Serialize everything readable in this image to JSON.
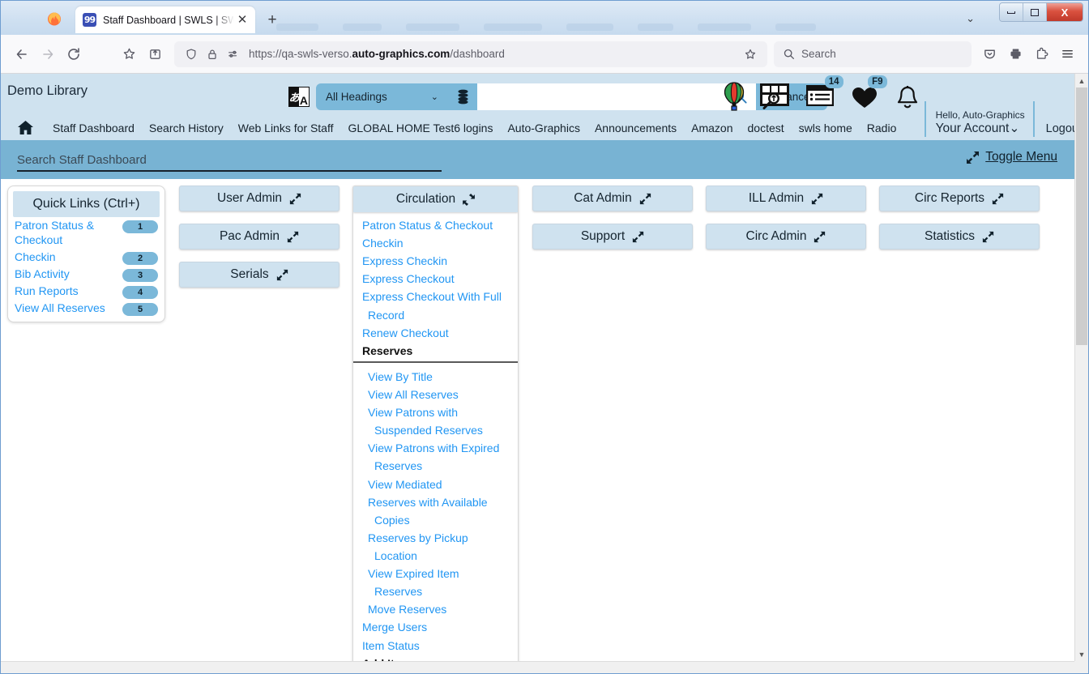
{
  "browser": {
    "tab": {
      "title": "Staff Dashboard | SWLS | SWLS",
      "favicon_name": "swls-favicon",
      "close_label": "✕"
    },
    "new_tab_label": "+",
    "list_all_tabs_label": "⌄",
    "window_controls": {
      "minimize": "minimize",
      "maximize": "maximize",
      "close": "X"
    },
    "toolbar": {
      "back": "←",
      "forward": "→",
      "reload": "↻",
      "bookmark_this": "bookmark-star",
      "save_to_collection": "save-to-collection",
      "shield": "tracking-protection",
      "lock": "connection-secure",
      "permissions": "site-permissions",
      "url_prefix": "https://qa-swls-verso.",
      "url_domain": "auto-graphics.com",
      "url_suffix": "/dashboard",
      "star": "☆",
      "search_placeholder": "Search",
      "pocket": "save-to-pocket",
      "print": "print",
      "extensions": "extensions",
      "app_menu": "≡"
    }
  },
  "app": {
    "library_name": "Demo Library",
    "search": {
      "lang_icon_letter": "A",
      "scope_value": "All Headings",
      "scope_chevron": "⌄",
      "db_icon": "database-icon",
      "input_value": "",
      "input_placeholder": "",
      "go_icon": "search-icon",
      "advanced_label": "Advanced"
    },
    "header_icons": [
      {
        "name": "balloon-icon",
        "badge": null
      },
      {
        "name": "image-search-icon",
        "badge": null
      },
      {
        "name": "list-card-icon",
        "badge": "14"
      },
      {
        "name": "heart-icon",
        "badge": "F9"
      },
      {
        "name": "bell-icon",
        "badge": null
      }
    ],
    "account": {
      "hello": "Hello, Auto-Graphics",
      "link": "Your Account",
      "chevron": "⌄"
    },
    "logout_label": "Logout",
    "nav": {
      "home_icon": "home-icon",
      "links": [
        "Staff Dashboard",
        "Search History",
        "Web Links for Staff",
        "GLOBAL HOME Test6 logins",
        "Auto-Graphics",
        "Announcements",
        "Amazon",
        "doctest",
        "swls home",
        "Radio"
      ]
    }
  },
  "dashboard": {
    "search_placeholder": "Search Staff Dashboard",
    "search_value": "",
    "toggle_menu": {
      "label": "Toggle Menu",
      "icon": "expand-arrows-icon"
    },
    "quick_links": {
      "title": "Quick Links (Ctrl+)",
      "items": [
        {
          "label": "Patron Status & Checkout",
          "badge": "1"
        },
        {
          "label": "Checkin",
          "badge": "2"
        },
        {
          "label": "Bib Activity",
          "badge": "3"
        },
        {
          "label": "Run Reports",
          "badge": "4"
        },
        {
          "label": "View All Reserves",
          "badge": "5"
        }
      ]
    },
    "column_a_buttons": [
      {
        "label": "User Admin",
        "icon": "expand-arrows-icon"
      },
      {
        "label": "Pac Admin",
        "icon": "expand-arrows-icon"
      },
      {
        "label": "Serials",
        "icon": "expand-arrows-icon"
      }
    ],
    "circulation": {
      "title": "Circulation",
      "icon": "collapse-arrows-icon",
      "items": [
        "Patron Status & Checkout",
        "Checkin",
        "Express Checkin",
        "Express Checkout",
        "Express Checkout With Full",
        "Record",
        "Renew Checkout"
      ],
      "reserves_heading": "Reserves",
      "reserves_items": [
        "View By Title",
        "View All Reserves",
        "View Patrons with",
        "Suspended Reserves",
        "View Patrons with Expired",
        "Reserves",
        "View Mediated",
        "Reserves with Available",
        "Copies",
        "Reserves by Pickup",
        "Location",
        "View Expired Item",
        "Reserves",
        "Move Reserves"
      ],
      "tail_items": [
        "Merge Users",
        "Item Status"
      ],
      "add_item_heading": "Add Item"
    },
    "column_c_buttons": [
      {
        "label": "Cat Admin",
        "icon": "expand-arrows-icon"
      },
      {
        "label": "Support",
        "icon": "expand-arrows-icon"
      }
    ],
    "column_d_buttons": [
      {
        "label": "ILL Admin",
        "icon": "expand-arrows-icon"
      },
      {
        "label": "Circ Admin",
        "icon": "expand-arrows-icon"
      }
    ],
    "column_e_buttons": [
      {
        "label": "Circ Reports",
        "icon": "expand-arrows-icon"
      },
      {
        "label": "Statistics",
        "icon": "expand-arrows-icon"
      }
    ]
  },
  "colors": {
    "app_header_bg": "#cfe2ef",
    "accent_blue": "#7bb8d9",
    "strip_blue": "#78b3d3",
    "link_blue": "#2196f3",
    "text_dark": "#15242f"
  }
}
